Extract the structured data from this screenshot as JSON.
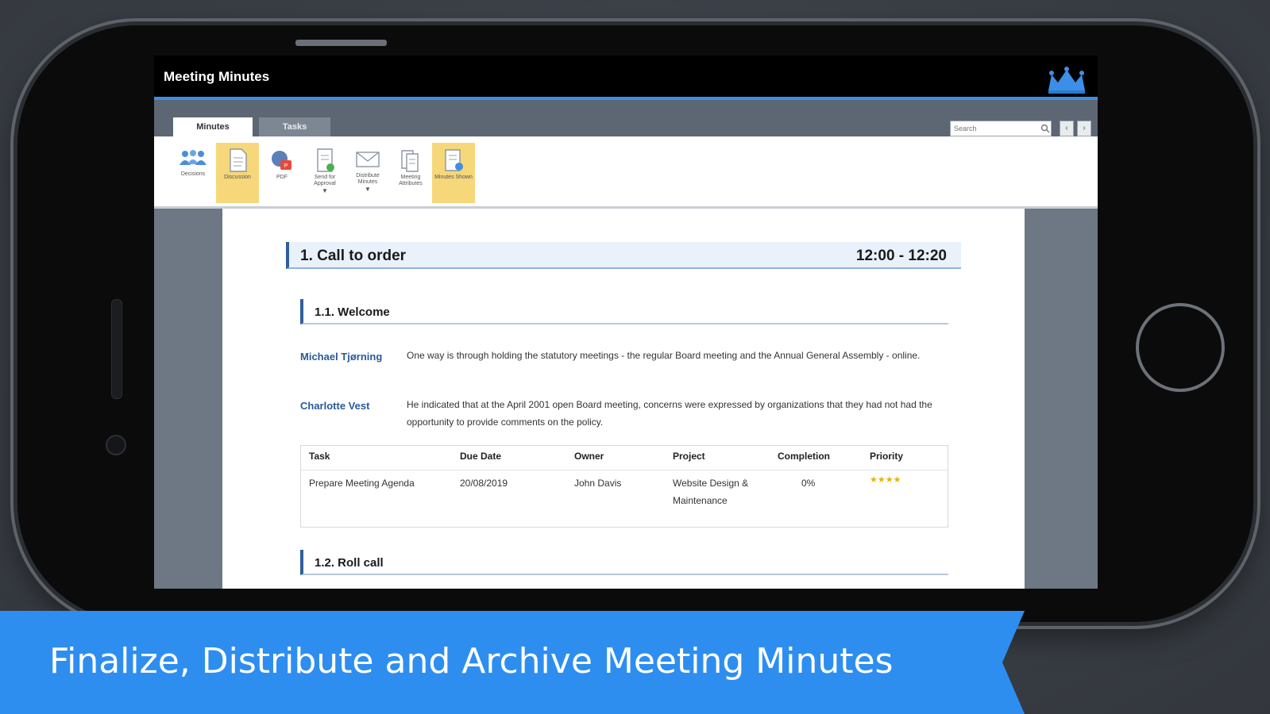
{
  "app": {
    "title": "Meeting Minutes"
  },
  "tabs": [
    {
      "label": "Minutes",
      "active": true
    },
    {
      "label": "Tasks",
      "active": false
    }
  ],
  "search": {
    "placeholder": "Search"
  },
  "nav": {
    "prev": "‹",
    "next": "›"
  },
  "toolbar": [
    {
      "label": "Decisions",
      "icon": "people-icon",
      "highlighted": false
    },
    {
      "label": "Discussion",
      "icon": "document-icon",
      "highlighted": true
    },
    {
      "label": "PDF",
      "icon": "pdf-icon",
      "highlighted": false
    },
    {
      "label": "Send for Approval",
      "icon": "approval-icon",
      "highlighted": false,
      "dropdown": true
    },
    {
      "label": "Distribute Minutes",
      "icon": "envelope-icon",
      "highlighted": false,
      "dropdown": true
    },
    {
      "label": "Meeting Attributes",
      "icon": "attributes-icon",
      "highlighted": false
    },
    {
      "label": "Minutes Shown",
      "icon": "minutes-icon",
      "highlighted": true
    }
  ],
  "document": {
    "section1": {
      "title": "1. Call to order",
      "time": "12:00 - 12:20"
    },
    "sub1": {
      "title": "1.1. Welcome"
    },
    "entries": [
      {
        "speaker": "Michael Tjørning",
        "text": "One way is through holding the statutory meetings - the regular Board meeting and the Annual General Assembly - online."
      },
      {
        "speaker": "Charlotte Vest",
        "text": "He indicated that at the April 2001 open Board meeting, concerns were expressed by organizations that they had not had the opportunity to provide comments on the policy."
      }
    ],
    "task_table": {
      "headers": [
        "Task",
        "Due Date",
        "Owner",
        "Project",
        "Completion",
        "Priority"
      ],
      "rows": [
        {
          "task": "Prepare Meeting Agenda",
          "due_date": "20/08/2019",
          "owner": "John Davis",
          "project": "Website Design & Maintenance",
          "completion": "0%",
          "priority": "★★★★"
        }
      ]
    },
    "sub2": {
      "title": "1.2. Roll call"
    }
  },
  "banner": {
    "text": "Finalize, Distribute and Archive Meeting Minutes"
  },
  "colors": {
    "accent_blue": "#3c8fe6",
    "banner_blue": "#2d8ef0",
    "highlight": "#f6d77a",
    "speaker_name": "#2a5a9a"
  }
}
